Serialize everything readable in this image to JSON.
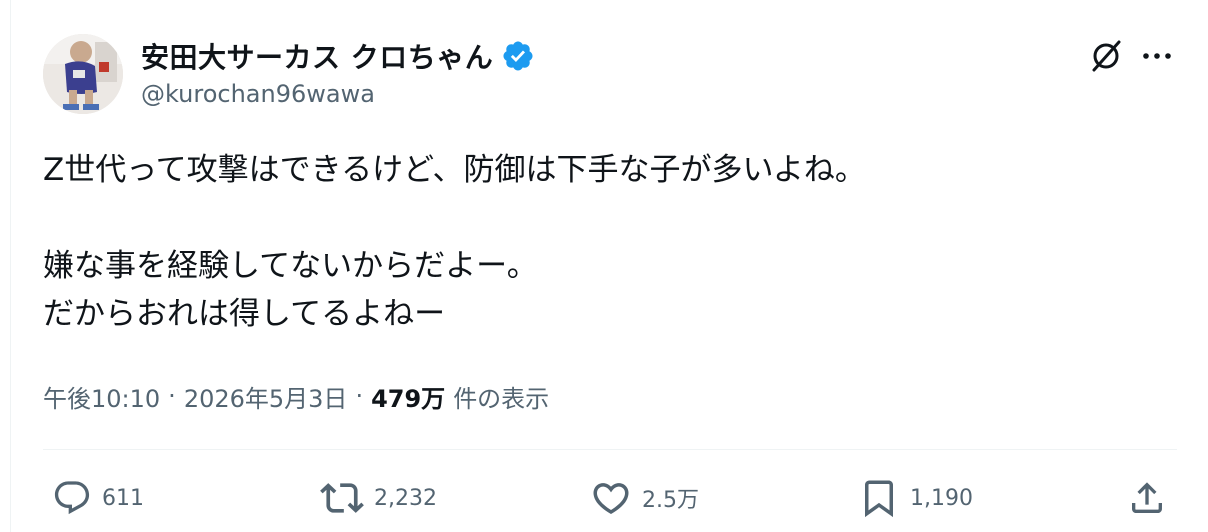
{
  "author": {
    "display_name": "安田大サーカス クロちゃん",
    "handle": "@kurochan96wawa",
    "verified": true,
    "verified_color": "#1d9bf0"
  },
  "tweet": {
    "lines": [
      "Z世代って攻撃はできるけど、防御は下手な子が多いよね。",
      "嫌な事を経験してないからだよー。",
      "だからおれは得してるよねー"
    ]
  },
  "meta": {
    "time": "午後10:10",
    "separator": "·",
    "date": "2026年5月3日",
    "views_count": "479万",
    "views_label": "件の表示"
  },
  "actions": {
    "reply_count": "611",
    "retweet_count": "2,232",
    "like_count": "2.5万",
    "bookmark_count": "1,190"
  },
  "icons": {
    "header": [
      "grok-icon",
      "more-icon"
    ],
    "actions": [
      "reply-icon",
      "retweet-icon",
      "like-icon",
      "bookmark-icon",
      "share-icon"
    ]
  },
  "colors": {
    "text_primary": "#0f1419",
    "text_secondary": "#536471",
    "divider": "#eff3f4"
  }
}
